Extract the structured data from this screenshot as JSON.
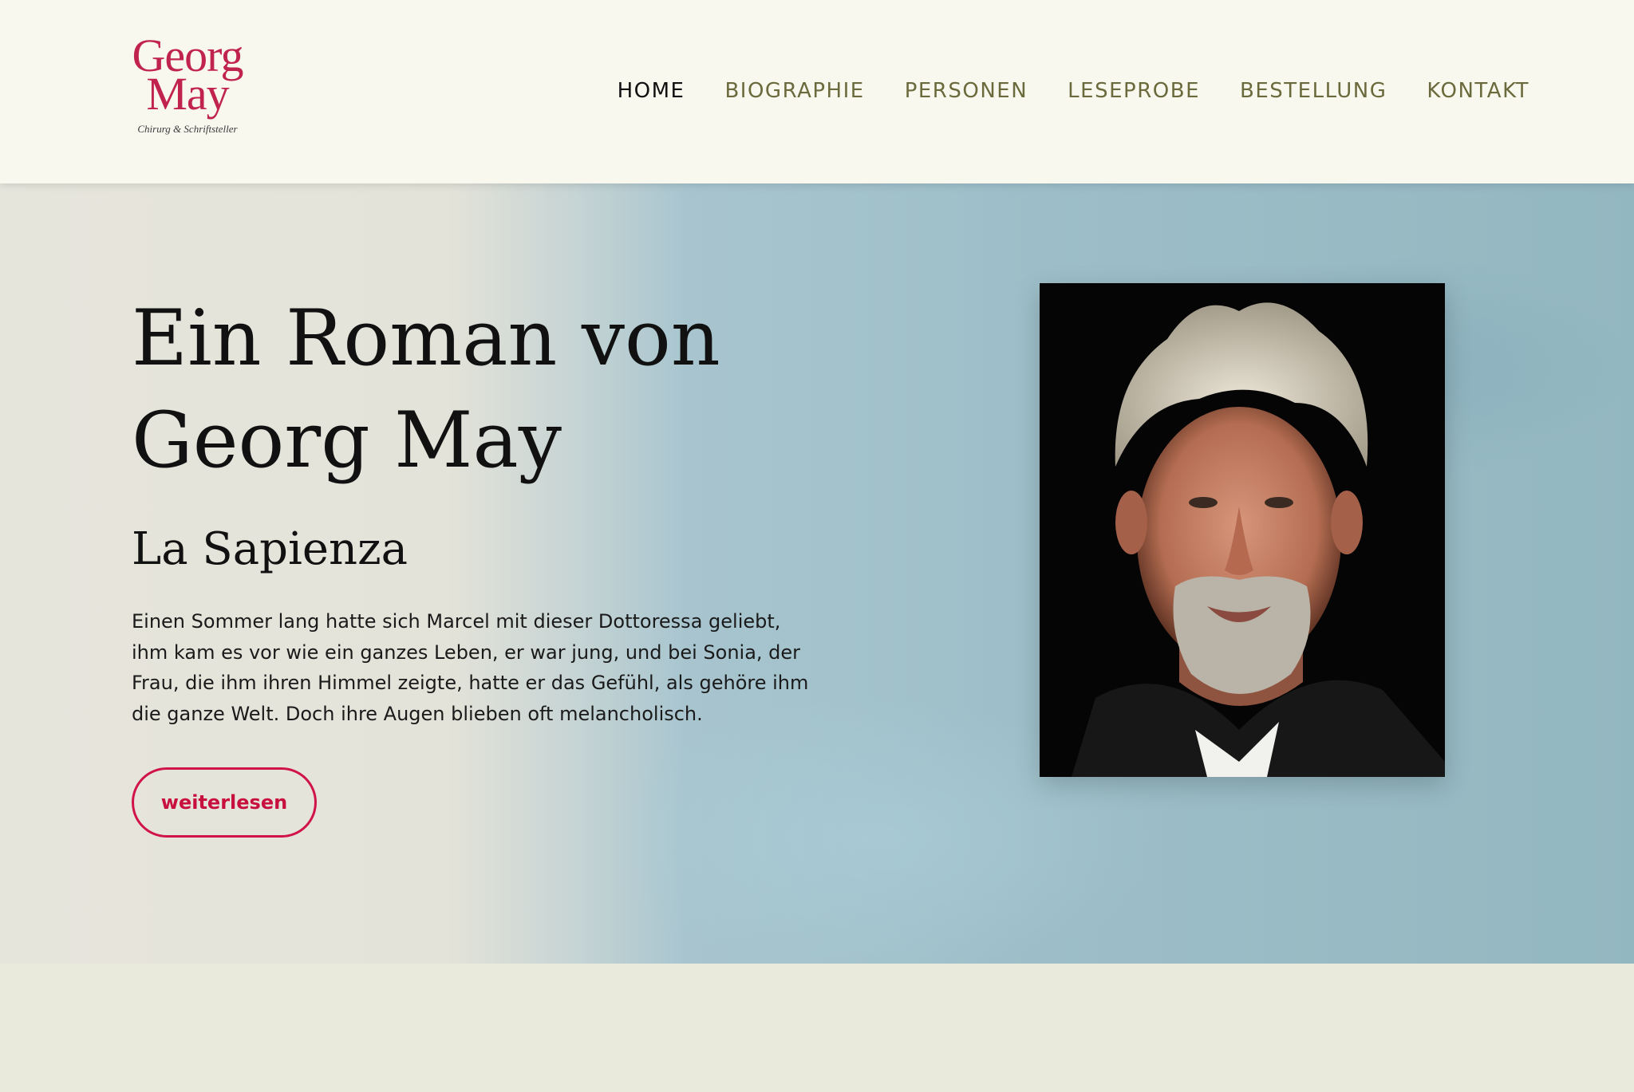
{
  "header": {
    "logo": {
      "line1": "Georg",
      "line2": "May",
      "tagline": "Chirurg & Schriftsteller"
    },
    "nav": [
      {
        "label": "HOME",
        "active": true
      },
      {
        "label": "BIOGRAPHIE",
        "active": false
      },
      {
        "label": "PERSONEN",
        "active": false
      },
      {
        "label": "LESEPROBE",
        "active": false
      },
      {
        "label": "BESTELLUNG",
        "active": false
      },
      {
        "label": "KONTAKT",
        "active": false
      }
    ]
  },
  "hero": {
    "title_line1": "Ein Roman von",
    "title_line2": "Georg May",
    "subtitle": "La Sapienza",
    "body": "Einen Sommer lang hatte sich Marcel mit dieser Dottoressa geliebt, ihm kam es vor wie ein ganzes Leben, er war jung, und bei Sonia, der Frau, die ihm ihren Himmel zeigte, hatte er das Gefühl, als gehöre ihm die ganze Welt. Doch ihre Augen blieben oft melancholisch.",
    "cta_label": "weiterlesen",
    "portrait_icon": "author-portrait"
  },
  "colors": {
    "accent": "#c1234f",
    "nav_text": "#6b6a3c",
    "header_bg": "#f9f8ef",
    "footer_bg": "#e9e9dc"
  }
}
